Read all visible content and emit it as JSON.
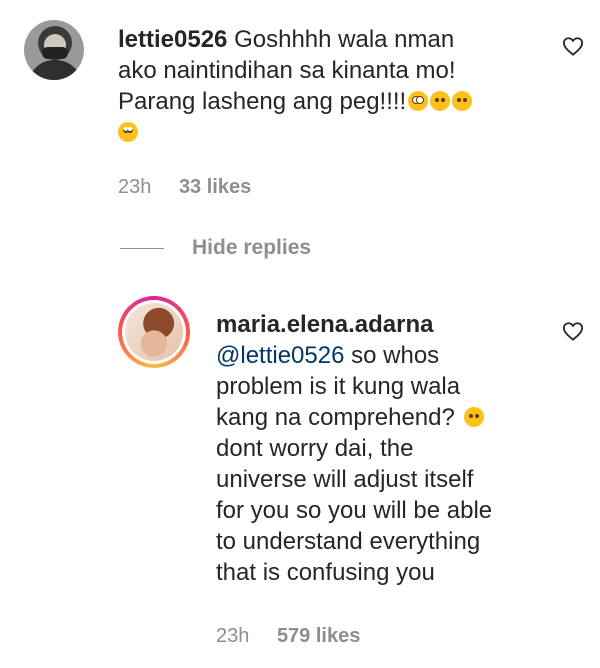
{
  "comments": [
    {
      "username": "lettie0526",
      "lines": [
        "Goshhhh wala nman",
        "ako naintindihan sa kinanta mo!",
        "Parang lasheng ang peg!!!!"
      ],
      "emojis_line3": [
        "flushed-face",
        "face-with-raised-eyebrow",
        "woozy-face"
      ],
      "emojis_line4": [
        "face-with-rolling-eyes"
      ],
      "time": "23h",
      "likes": "33 likes"
    },
    {
      "username": "maria.elena.adarna",
      "mention": "@lettie0526",
      "line1_rest": " so whos",
      "lines": [
        "problem is it kung wala",
        "kang na comprehend?",
        "dont worry dai, the",
        "universe will adjust itself",
        "for you so you will be able",
        "to understand everything",
        "that is confusing you"
      ],
      "emoji_after_comprehend": "woozy-face",
      "time": "23h",
      "likes": "579 likes"
    }
  ],
  "hide_replies": "Hide replies",
  "icons": {
    "like": "heart-outline-icon"
  }
}
